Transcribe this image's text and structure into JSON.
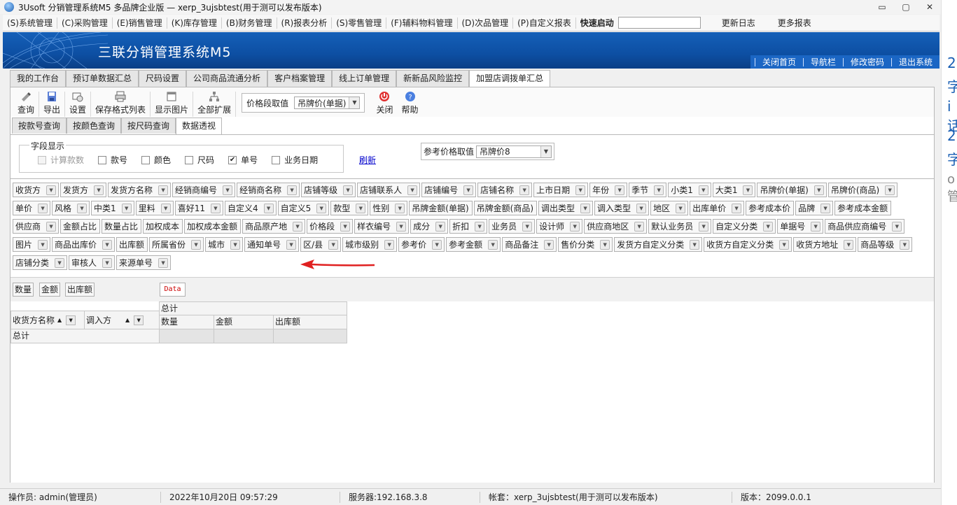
{
  "window": {
    "title": "3Usoft 分销管理系统M5 多品牌企业版 — xerp_3ujsbtest(用于测可以发布版本)",
    "controls": [
      "▭",
      "▢",
      "✕"
    ]
  },
  "menu": {
    "items": [
      "(S)系统管理",
      "(C)采购管理",
      "(E)销售管理",
      "(K)库存管理",
      "(B)财务管理",
      "(R)报表分析",
      "(S)零售管理",
      "(F)辅料物料管理",
      "(D)次品管理",
      "(P)自定义报表"
    ],
    "quick_start": "快速启动",
    "quick_input": "",
    "links": [
      "更新日志",
      "更多报表"
    ]
  },
  "banner": {
    "brand": "三联分销管理系统M5",
    "nav": [
      "关闭首页",
      "导航栏",
      "修改密码",
      "退出系统"
    ],
    "color": "#0d4fa3"
  },
  "main_tabs": [
    "我的工作台",
    "预订单数据汇总",
    "尺码设置",
    "公司商品流通分析",
    "客户档案管理",
    "线上订单管理",
    "新新品风险监控",
    "加盟店调拨单汇总"
  ],
  "main_tab_active": 7,
  "toolbar": {
    "buttons": [
      {
        "label": "查询",
        "icon": "query-icon"
      },
      {
        "label": "导出",
        "icon": "export-icon"
      },
      {
        "label": "设置",
        "icon": "settings-icon"
      },
      {
        "label": "保存格式列表",
        "icon": "save-format-icon"
      },
      {
        "label": "显示图片",
        "icon": "image-icon"
      },
      {
        "label": "全部扩展",
        "icon": "expand-icon"
      }
    ],
    "price_label": "价格段取值",
    "price_value": "吊牌价(单据)",
    "close_label": "关闭",
    "help_label": "帮助"
  },
  "sub_tabs": [
    "按款号查询",
    "按颜色查询",
    "按尺码查询",
    "数据透视"
  ],
  "sub_tab_active": 3,
  "field_display": {
    "legend": "字段显示",
    "checkboxes": [
      {
        "label": "计算款数",
        "checked": false,
        "disabled": true
      },
      {
        "label": "款号",
        "checked": false,
        "disabled": false
      },
      {
        "label": "颜色",
        "checked": false,
        "disabled": false
      },
      {
        "label": "尺码",
        "checked": false,
        "disabled": false
      },
      {
        "label": "单号",
        "checked": true,
        "disabled": false
      },
      {
        "label": "业务日期",
        "checked": false,
        "disabled": false
      }
    ],
    "refresh": "刷新",
    "ref_price_label": "参考价格取值",
    "ref_price_value": "吊牌价8"
  },
  "field_list": [
    {
      "label": "收货方",
      "dd": true
    },
    {
      "label": "发货方",
      "dd": true
    },
    {
      "label": "发货方名称",
      "dd": true
    },
    {
      "label": "经销商编号",
      "dd": true
    },
    {
      "label": "经销商名称",
      "dd": true
    },
    {
      "label": "店铺等级",
      "dd": true
    },
    {
      "label": "店铺联系人",
      "dd": true
    },
    {
      "label": "店铺编号",
      "dd": true
    },
    {
      "label": "店铺名称",
      "dd": true
    },
    {
      "label": "上市日期",
      "dd": true
    },
    {
      "label": "年份",
      "dd": true
    },
    {
      "label": "季节",
      "dd": true
    },
    {
      "label": "小类1",
      "dd": true
    },
    {
      "label": "大类1",
      "dd": true
    },
    {
      "label": "吊牌价(单据)",
      "dd": true
    },
    {
      "label": "吊牌价(商品)",
      "dd": true
    },
    {
      "label": "单价",
      "dd": true
    },
    {
      "label": "风格",
      "dd": true
    },
    {
      "label": "中类1",
      "dd": true
    },
    {
      "label": "里料",
      "dd": true
    },
    {
      "label": "喜好11",
      "dd": true
    },
    {
      "label": "自定义4",
      "dd": true
    },
    {
      "label": "自定义5",
      "dd": true
    },
    {
      "label": "款型",
      "dd": true
    },
    {
      "label": "性别",
      "dd": true
    },
    {
      "label": "吊牌金额(单据)",
      "dd": false
    },
    {
      "label": "吊牌金额(商品)",
      "dd": false
    },
    {
      "label": "调出类型",
      "dd": true
    },
    {
      "label": "调入类型",
      "dd": true
    },
    {
      "label": "地区",
      "dd": true
    },
    {
      "label": "出库单价",
      "dd": true
    },
    {
      "label": "参考成本价",
      "dd": false
    },
    {
      "label": "品牌",
      "dd": true
    },
    {
      "label": "参考成本金额",
      "dd": false
    },
    {
      "label": "供应商",
      "dd": true
    },
    {
      "label": "金额占比",
      "dd": false
    },
    {
      "label": "数量占比",
      "dd": false
    },
    {
      "label": "加权成本",
      "dd": false
    },
    {
      "label": "加权成本金额",
      "dd": false
    },
    {
      "label": "商品原产地",
      "dd": true
    },
    {
      "label": "价格段",
      "dd": true
    },
    {
      "label": "样衣编号",
      "dd": true
    },
    {
      "label": "成分",
      "dd": true
    },
    {
      "label": "折扣",
      "dd": true
    },
    {
      "label": "业务员",
      "dd": true
    },
    {
      "label": "设计师",
      "dd": true
    },
    {
      "label": "供应商地区",
      "dd": true
    },
    {
      "label": "默认业务员",
      "dd": true
    },
    {
      "label": "自定义分类",
      "dd": true
    },
    {
      "label": "单据号",
      "dd": true
    },
    {
      "label": "商品供应商编号",
      "dd": true
    },
    {
      "label": "图片",
      "dd": true
    },
    {
      "label": "商品出库价",
      "dd": true
    },
    {
      "label": "出库额",
      "dd": false
    },
    {
      "label": "所属省份",
      "dd": true
    },
    {
      "label": "城市",
      "dd": true
    },
    {
      "label": "通知单号",
      "dd": true
    },
    {
      "label": "区/县",
      "dd": true
    },
    {
      "label": "城市级别",
      "dd": true
    },
    {
      "label": "参考价",
      "dd": true
    },
    {
      "label": "参考金额",
      "dd": true
    },
    {
      "label": "商品备注",
      "dd": true
    },
    {
      "label": "售价分类",
      "dd": true
    },
    {
      "label": "发货方自定义分类",
      "dd": true
    },
    {
      "label": "收货方自定义分类",
      "dd": true
    },
    {
      "label": "收货方地址",
      "dd": true
    },
    {
      "label": "商品等级",
      "dd": true
    },
    {
      "label": "店铺分类",
      "dd": true
    },
    {
      "label": "审核人",
      "dd": true
    },
    {
      "label": "来源单号",
      "dd": true
    }
  ],
  "pivot": {
    "data_fields": [
      "数量",
      "金额",
      "出库额"
    ],
    "data_label": "Data",
    "row_fields": [
      "收货方名称",
      "调入方"
    ],
    "total_label": "总计",
    "columns": [
      "数量",
      "金额",
      "出库额"
    ],
    "grand_total_label": "总计"
  },
  "status": {
    "operator": "操作员: admin(管理员)",
    "datetime": "2022年10月20日 09:57:29",
    "server": "服务器:192.168.3.8",
    "account": "帐套：xerp_3ujsbtest(用于测可以发布版本)",
    "version": "版本：2099.0.0.1"
  },
  "right_strip": [
    "2",
    "字",
    "i话",
    "2",
    "字",
    "o管"
  ],
  "colors": {
    "accent": "#1560b8",
    "link": "#0000cc",
    "arrow": "#e02020",
    "data_label": "#cc0000"
  }
}
